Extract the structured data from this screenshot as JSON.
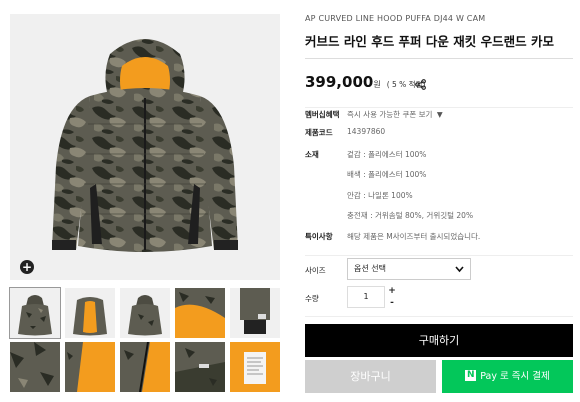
{
  "product": {
    "brand": "AP CURVED LINE HOOD PUFFA DJ44 W CAM",
    "name": "커브드 라인 후드 푸퍼 다운 재킷 우드랜드 카모",
    "price": "399,000",
    "price_unit": "원",
    "point_rate": "( 5 % 적립)"
  },
  "info": {
    "membership_label": "멤버십혜택",
    "membership_value": "즉시 사용 가능한 쿠폰 보기",
    "membership_arrow": "▼",
    "code_label": "제품코드",
    "code_value": "14397860",
    "material_label": "소재",
    "material_lines": [
      "겉감 : 폴리에스터 100%",
      "배색 : 폴리에스터 100%",
      "안감 : 나일론 100%",
      "충전재 : 거위솜털 80%, 거위깃털 20%"
    ],
    "note_label": "특이사항",
    "note_value": "해당 제품은 M사이즈부터 출시되었습니다."
  },
  "options": {
    "size_label": "사이즈",
    "size_select": "옵션 선택",
    "qty_label": "수량",
    "qty_value": "1",
    "plus": "+",
    "minus": "-"
  },
  "actions": {
    "buy": "구매하기",
    "cart": "장바구니",
    "npay_logo": "N",
    "npay": "Pay 로 즉시 결제"
  },
  "gallery": {
    "zoom": "+",
    "thumb_count": 10
  },
  "colors": {
    "npay_green": "#03c75a",
    "buy_black": "#000000",
    "cart_gray": "#cfcfcf",
    "lining_orange": "#f39c1e"
  }
}
